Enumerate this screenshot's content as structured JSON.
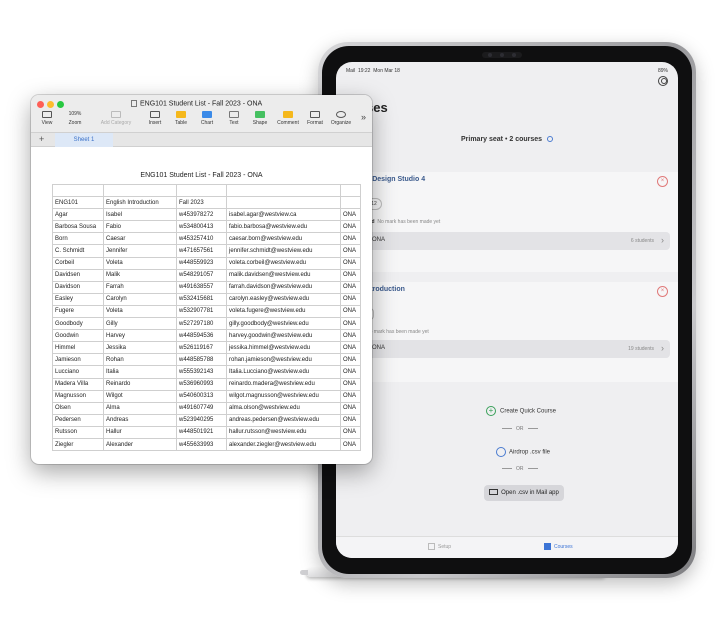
{
  "ipad": {
    "status_time": "19:22",
    "status_date": "Mon Mar 18",
    "status_app": "Mail",
    "battery": "89%",
    "title": "ses",
    "seat_label": "Primary seat",
    "seat_sep": "•",
    "courses_count": "2 courses",
    "courses": [
      {
        "name": "n Design Studio 4",
        "sub": "22",
        "pill": "12",
        "mark_label": "sed",
        "mark_text": "No mark has been made yet",
        "section": "ONA",
        "students": "6 students"
      },
      {
        "name": "ntroduction",
        "sub": "",
        "pill": "",
        "mark_label": "",
        "mark_text": "No mark has been made yet",
        "section": "ONA",
        "students": "19 students"
      }
    ],
    "quick_course": "Create Quick Course",
    "or1": "OR",
    "airdrop": "Airdrop .csv file",
    "or2": "OR",
    "mail_button": "Open .csv in Mail app",
    "tabs": [
      {
        "label": "Setup"
      },
      {
        "label": "Courses"
      }
    ],
    "accent": "#3c74d6"
  },
  "numbers": {
    "window_title": "ENG101 Student List - Fall 2023 - ONA",
    "toolbar": [
      {
        "label": "View",
        "icon": "view-icon"
      },
      {
        "label": "Zoom",
        "value": "109%",
        "icon": "zoom-icon"
      },
      {
        "label": "Add Category",
        "icon": "add-category-icon",
        "disabled": true
      },
      {
        "label": "Insert",
        "icon": "insert-icon"
      },
      {
        "label": "Table",
        "icon": "table-icon"
      },
      {
        "label": "Chart",
        "icon": "chart-icon"
      },
      {
        "label": "Text",
        "icon": "text-icon"
      },
      {
        "label": "Shape",
        "icon": "shape-icon"
      },
      {
        "label": "Comment",
        "icon": "comment-icon"
      },
      {
        "label": "Format",
        "icon": "format-icon"
      },
      {
        "label": "Organize",
        "icon": "organize-icon"
      }
    ],
    "sheet_add": "+",
    "sheet_tab": "Sheet 1",
    "table_title": "ENG101 Student List - Fall 2023 - ONA",
    "header_row": [
      "ENG101",
      "English Introduction",
      "Fall 2023",
      "",
      ""
    ],
    "rows": [
      [
        "Agar",
        "Isabel",
        "w453978272",
        "isabel.agar@westview.ca",
        "ONA"
      ],
      [
        "Barbosa Sousa",
        "Fabio",
        "w534800413",
        "fabio.barbosa@westview.edu",
        "ONA"
      ],
      [
        "Born",
        "Caesar",
        "w453257410",
        "caesar.born@westview.edu",
        "ONA"
      ],
      [
        "C. Schmidt",
        "Jennifer",
        "w471657561",
        "jennifer.schmidt@westview.edu",
        "ONA"
      ],
      [
        "Corbeil",
        "Voleta",
        "w448559923",
        "voleta.corbeil@westview.edu",
        "ONA"
      ],
      [
        "Davidsen",
        "Malik",
        "w548291057",
        "malik.davidsen@westview.edu",
        "ONA"
      ],
      [
        "Davidson",
        "Farrah",
        "w491638557",
        "farrah.davidson@westview.edu",
        "ONA"
      ],
      [
        "Easley",
        "Carolyn",
        "w532415681",
        "carolyn.easley@westview.edu",
        "ONA"
      ],
      [
        "Fugere",
        "Voleta",
        "w532907781",
        "voleta.fugere@westview.edu",
        "ONA"
      ],
      [
        "Goodbody",
        "Gilly",
        "w527297180",
        "gilly.goodbody@westview.edu",
        "ONA"
      ],
      [
        "Goodwin",
        "Harvey",
        "w448594536",
        "harvey.goodwin@westview.edu",
        "ONA"
      ],
      [
        "Himmel",
        "Jessika",
        "w526119167",
        "jessika.himmel@westview.edu",
        "ONA"
      ],
      [
        "Jamieson",
        "Rohan",
        "w448585788",
        "rohan.jamieson@westview.edu",
        "ONA"
      ],
      [
        "Lucciano",
        "Italia",
        "w555392143",
        "Italia.Lucciano@westview.edu",
        "ONA"
      ],
      [
        "Madera Villa",
        "Reinardo",
        "w536960993",
        "reinardo.madera@westview.edu",
        "ONA"
      ],
      [
        "Magnusson",
        "Wilgot",
        "w540600313",
        "wilgot.magnusson@westview.edu",
        "ONA"
      ],
      [
        "Olsen",
        "Alma",
        "w491607749",
        "alma.olson@westview.edu",
        "ONA"
      ],
      [
        "Pedersen",
        "Andreas",
        "w523940295",
        "andreas.pedersen@westview.edu",
        "ONA"
      ],
      [
        "Rutsson",
        "Hallur",
        "w448501921",
        "hallur.rutsson@westview.edu",
        "ONA"
      ],
      [
        "Ziegler",
        "Alexander",
        "w455633993",
        "alexander.ziegler@westview.edu",
        "ONA"
      ]
    ]
  }
}
